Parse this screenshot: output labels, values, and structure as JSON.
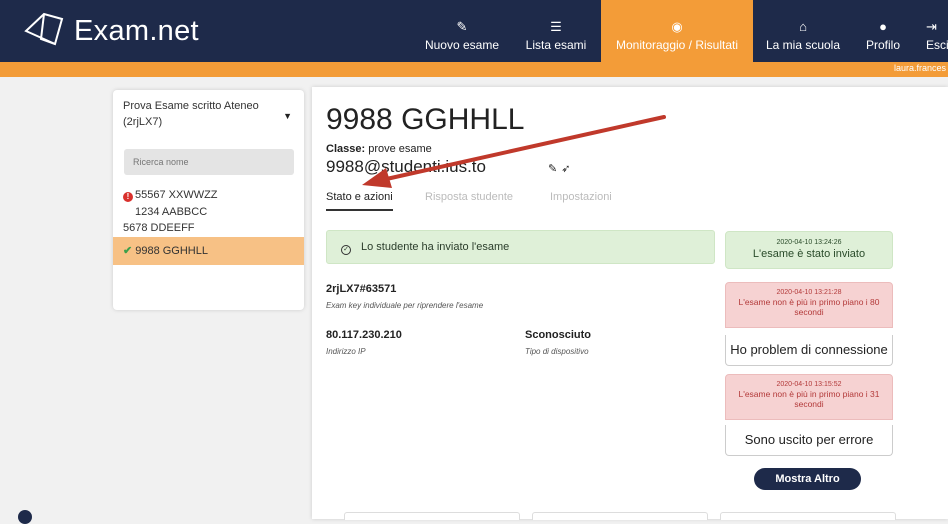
{
  "app": {
    "logo_text": "Exam.net"
  },
  "nav": [
    {
      "label": "Nuovo esame",
      "icon": "pencil-icon"
    },
    {
      "label": "Lista esami",
      "icon": "list-icon"
    },
    {
      "label": "Monitoraggio / Risultati",
      "icon": "eye-icon"
    },
    {
      "label": "La mia scuola",
      "icon": "home-icon"
    },
    {
      "label": "Profilo",
      "icon": "user-icon"
    },
    {
      "label": "Esci",
      "icon": "logout-icon"
    }
  ],
  "user": {
    "name": "laura.frances"
  },
  "sidebar": {
    "exam_title": "Prova Esame scritto Ateneo (2rjLX7)",
    "search_placeholder": "Ricerca nome",
    "students": [
      {
        "name": "55567 XXWWZZ",
        "flag": "error"
      },
      {
        "name": "1234 AABBCC",
        "flag": ""
      },
      {
        "name": "5678 DDEEFF",
        "flag": ""
      },
      {
        "name": "9988 GGHHLL",
        "flag": "submitted"
      }
    ]
  },
  "student": {
    "name": "9988 GGHHLL",
    "class_label": "Classe:",
    "class_value": "prove esame",
    "email": "9988@studenti.ius.to"
  },
  "tabs": [
    {
      "label": "Stato e azioni",
      "active": true
    },
    {
      "label": "Risposta studente",
      "active": false
    },
    {
      "label": "Impostazioni",
      "active": false
    }
  ],
  "status": {
    "alert": "Lo studente ha inviato l'esame"
  },
  "details": {
    "exam_key": "2rjLX7#63571",
    "exam_key_hint": "Exam key individuale per riprendere l'esame",
    "ip": "80.117.230.210",
    "ip_hint": "Indirizzo IP",
    "device": "Sconosciuto",
    "device_hint": "Tipo di dispositivo"
  },
  "events": [
    {
      "time": "2020-04-10 13:24:26",
      "message": "L'esame è stato inviato",
      "type": "success"
    },
    {
      "time": "2020-04-10 13:21:28",
      "message": "L'esame non è più in primo piano i 80 secondi",
      "type": "warning",
      "reason": "Ho problem di connessione"
    },
    {
      "time": "2020-04-10 13:15:52",
      "message": "L'esame non è più in primo piano i 31 secondi",
      "type": "warning",
      "reason": "Sono uscito per errore"
    }
  ],
  "actions": {
    "show_more": "Mostra Altro"
  },
  "colors": {
    "navy": "#1e2a4a",
    "orange": "#f39c38",
    "arrow": "#c0392b"
  }
}
